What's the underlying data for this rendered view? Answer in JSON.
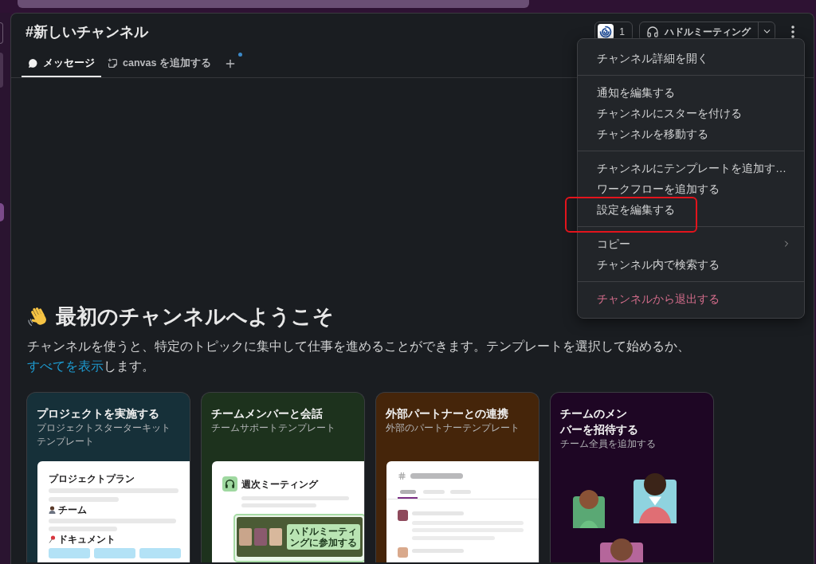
{
  "channel": {
    "title": "#新しいチャンネル",
    "member_count": "1",
    "huddle_label": "ハドルミーティング"
  },
  "tabs": [
    {
      "kind": "messages",
      "label": "メッセージ",
      "selected": true
    },
    {
      "kind": "canvas",
      "label": "canvas を追加する",
      "selected": false
    }
  ],
  "add_tab_dot": true,
  "menu": {
    "sections": [
      {
        "items": [
          {
            "kind": "normal",
            "label": "チャンネル詳細を開く",
            "highlighted": false
          }
        ]
      },
      {
        "items": [
          {
            "kind": "normal",
            "label": "通知を編集する",
            "highlighted": false
          },
          {
            "kind": "normal",
            "label": "チャンネルにスターを付ける",
            "highlighted": false
          },
          {
            "kind": "normal",
            "label": "チャンネルを移動する",
            "highlighted": false
          }
        ]
      },
      {
        "items": [
          {
            "kind": "normal",
            "label": "チャンネルにテンプレートを追加す…",
            "highlighted": false
          },
          {
            "kind": "normal",
            "label": "ワークフローを追加する",
            "highlighted": false
          },
          {
            "kind": "normal",
            "label": "設定を編集する",
            "highlighted": true
          }
        ]
      },
      {
        "items": [
          {
            "kind": "submenu",
            "label": "コピー",
            "highlighted": false
          },
          {
            "kind": "normal",
            "label": "チャンネル内で検索する",
            "highlighted": false
          }
        ]
      },
      {
        "items": [
          {
            "kind": "danger",
            "label": "チャンネルから退出する",
            "highlighted": false
          }
        ]
      }
    ]
  },
  "welcome": {
    "heading": "最初のチャンネルへようこそ",
    "text": "チャンネルを使うと、特定のトピックに集中して仕事を進めることができます。テンプレートを選択して始めるか、",
    "link": "すべてを表示",
    "text_after": "します。"
  },
  "templates": [
    {
      "kind": "project",
      "title": "プロジェクトを実施する",
      "subtitle": "プロジェクトスターターキットテンプレート",
      "color": "#163039",
      "preview_title": "プロジェクトプラン",
      "preview_sections": [
        {
          "kind": "team",
          "label": "チーム"
        },
        {
          "kind": "docs",
          "label": "ドキュメント"
        }
      ]
    },
    {
      "kind": "huddle",
      "title": "チームメンバーと会話",
      "subtitle": "チームサポートテンプレート",
      "color": "#1d321d",
      "preview_title": "週次ミーティング",
      "join_label": "ハドルミーティングに参加する"
    },
    {
      "kind": "partner",
      "title": "外部パートナーとの連携",
      "subtitle": "外部のパートナーテンプレート",
      "color": "#45250a"
    },
    {
      "kind": "invite",
      "title": "チームのメンバーを招待する",
      "subtitle": "チーム全員を追加する",
      "color": "#1e0624"
    }
  ]
}
